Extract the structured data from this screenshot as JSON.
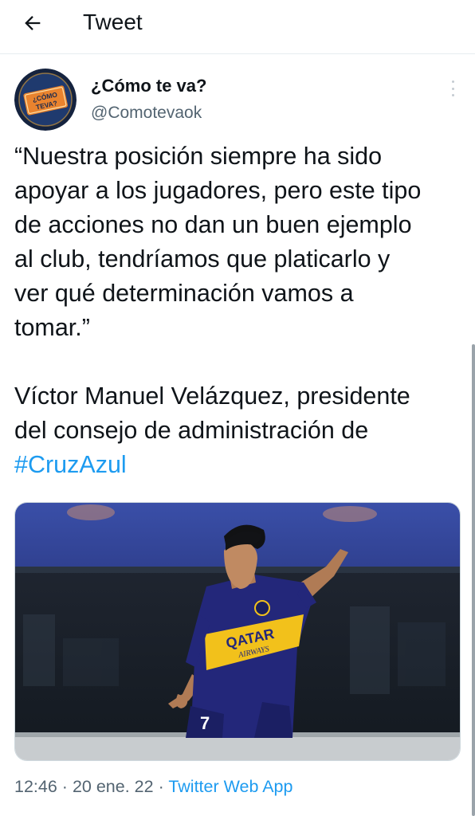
{
  "header": {
    "back_icon": "arrow-left-icon",
    "title": "Tweet"
  },
  "author": {
    "display_name": "¿Cómo te va?",
    "handle": "@Comotevaok",
    "avatar_text": [
      "¿CÓMO",
      "TEVA?"
    ],
    "more_icon": "vertical-dots-icon"
  },
  "tweet": {
    "quote": "“Nuestra posición siempre ha sido\napoyar a los jugadores, pero este tipo\nde acciones no dan un buen ejemplo\nal club, tendríamos que platicarlo y\nver qué determinación vamos a\ntomar.”",
    "attribution": "Víctor Manuel Velázquez, presidente\ndel consejo de administración de",
    "hashtag": "#CruzAzul"
  },
  "media": {
    "description_icon": "photo-icon",
    "jersey_sponsor": [
      "QATAR",
      "AIRWAYS"
    ],
    "jersey_number": "7"
  },
  "meta": {
    "time": "12:46",
    "separator": "·",
    "date": "20 ene. 22",
    "source": "Twitter Web App"
  },
  "colors": {
    "accent": "#1d9bf0",
    "secondary_text": "#536471",
    "jersey_blue": "#23277a",
    "jersey_gold": "#f2c11b"
  }
}
